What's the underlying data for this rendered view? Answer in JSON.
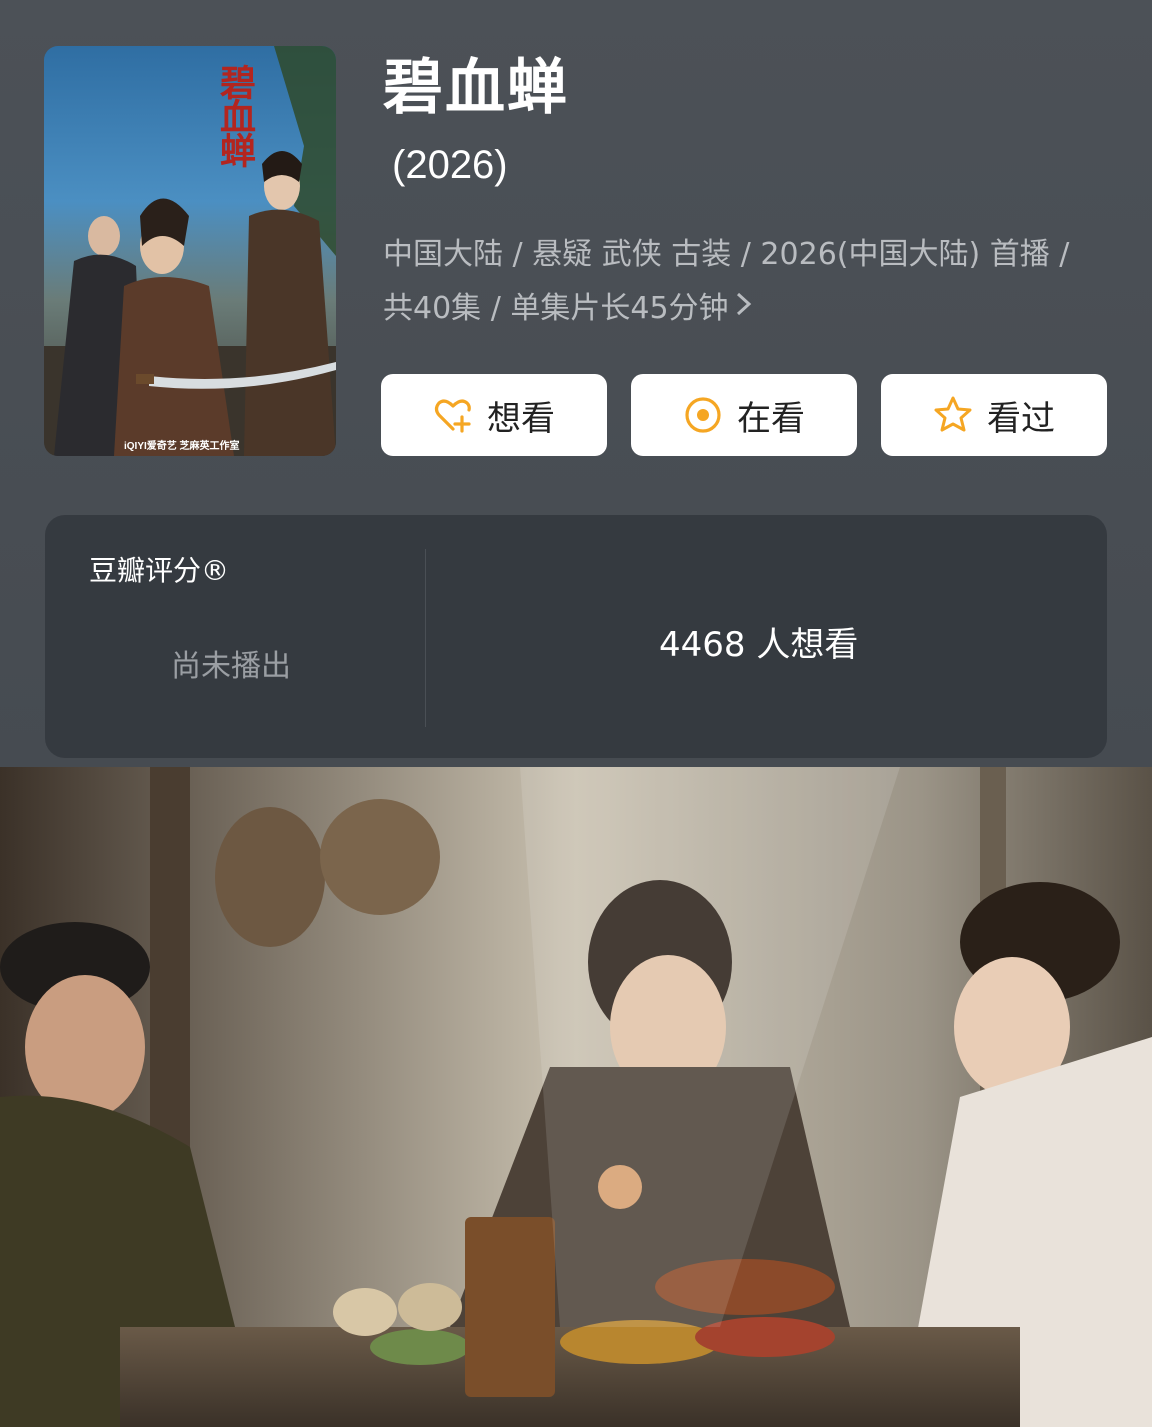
{
  "poster": {
    "title_art": "碧血蝉",
    "studio_text": "iQIYI爱奇艺   芝麻英工作室"
  },
  "title": "碧血蝉",
  "year": "(2026)",
  "meta": {
    "line1": "中国大陆 / 悬疑 武侠 古装 / 2026(中国大陆) 首播 /",
    "line2": "共40集 / 单集片长45分钟"
  },
  "actions": {
    "want": {
      "label": "想看",
      "icon": "heart-plus-icon"
    },
    "watching": {
      "label": "在看",
      "icon": "target-icon"
    },
    "watched": {
      "label": "看过",
      "icon": "star-icon"
    }
  },
  "rating": {
    "label": "豆瓣评分®",
    "status": "尚未播出",
    "want_count": "4468 人想看"
  },
  "colors": {
    "accent": "#f5a623",
    "background": "#474c52",
    "card": "#353a40"
  }
}
